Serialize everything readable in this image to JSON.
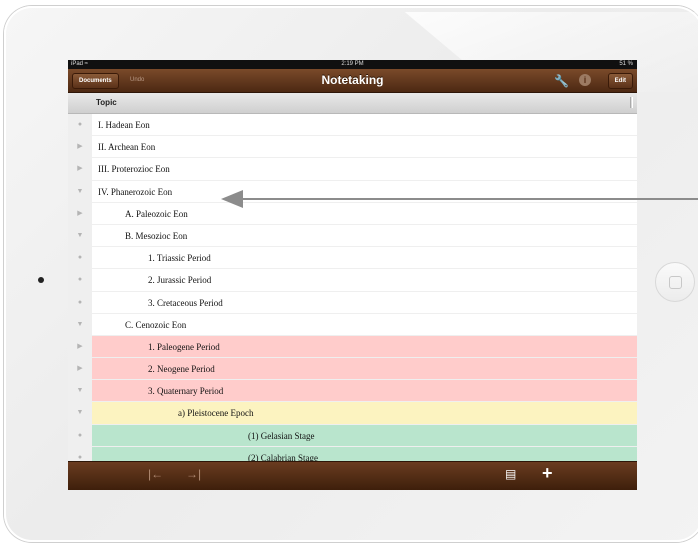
{
  "statusbar": {
    "carrier": "iPad ≈",
    "time": "2:19 PM",
    "battery": "51 %"
  },
  "navbar": {
    "documents": "Documents",
    "undo": "Undo",
    "title": "Notetaking",
    "edit": "Edit",
    "info": "i"
  },
  "column": {
    "title": "Topic"
  },
  "rows": [
    {
      "text": "I. Hadean Eon",
      "gutter": "●",
      "indent": 0,
      "color": ""
    },
    {
      "text": "II. Archean Eon",
      "gutter": "▶",
      "indent": 0,
      "color": ""
    },
    {
      "text": "III. Proterozioc Eon",
      "gutter": "▶",
      "indent": 0,
      "color": ""
    },
    {
      "text": "IV. Phanerozoic Eon",
      "gutter": "▼",
      "indent": 0,
      "color": ""
    },
    {
      "text": "A. Paleozoic Eon",
      "gutter": "▶",
      "indent": 1,
      "color": ""
    },
    {
      "text": "B. Mesozioc Eon",
      "gutter": "▼",
      "indent": 1,
      "color": ""
    },
    {
      "text": "1. Triassic Period",
      "gutter": "●",
      "indent": 2,
      "color": ""
    },
    {
      "text": "2. Jurassic Period",
      "gutter": "●",
      "indent": 2,
      "color": ""
    },
    {
      "text": "3. Cretaceous Period",
      "gutter": "●",
      "indent": 2,
      "color": ""
    },
    {
      "text": "C. Cenozoic Eon",
      "gutter": "▼",
      "indent": 1,
      "color": ""
    },
    {
      "text": "1. Paleogene Period",
      "gutter": "▶",
      "indent": 2,
      "color": "red"
    },
    {
      "text": "2. Neogene Period",
      "gutter": "▶",
      "indent": 2,
      "color": "red"
    },
    {
      "text": "3. Quaternary Period",
      "gutter": "▼",
      "indent": 2,
      "color": "red"
    },
    {
      "text": "a) Pleistocene Epoch",
      "gutter": "▼",
      "indent": 3,
      "color": "yellow"
    },
    {
      "text": "(1) Gelasian Stage",
      "gutter": "●",
      "indent": 4,
      "color": "green"
    },
    {
      "text": "(2) Calabrian Stage",
      "gutter": "●",
      "indent": 4,
      "color": "green"
    }
  ],
  "toolbar": {
    "outdent": "|←",
    "indent": "→|",
    "note": "▤",
    "add": "+"
  },
  "colors": {
    "red": "#ffcccb",
    "yellow": "#fcf3c0",
    "green": "#b9e5cd",
    "bar": "#5a3118"
  }
}
